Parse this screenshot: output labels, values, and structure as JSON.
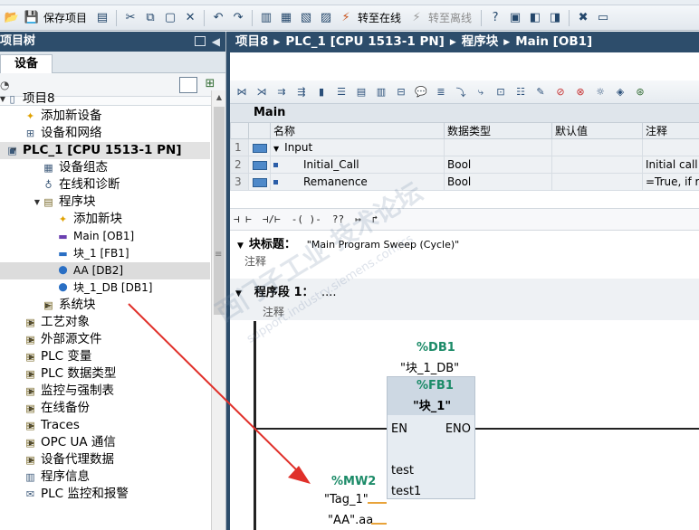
{
  "toolbar": {
    "save_project": "保存项目",
    "go_online": "转至在线",
    "go_offline": "转至离线"
  },
  "left": {
    "title": "项目树",
    "tab": "设备",
    "tree": [
      {
        "label": "项目8",
        "icon": "document-icon"
      },
      {
        "label": "添加新设备",
        "icon": "star-icon"
      },
      {
        "label": "设备和网络",
        "icon": "network-icon"
      },
      {
        "label": "PLC_1 [CPU 1513-1 PN]",
        "icon": "cpu-icon"
      },
      {
        "label": "设备组态",
        "icon": "config-icon"
      },
      {
        "label": "在线和诊断",
        "icon": "diagnostics-icon"
      },
      {
        "label": "程序块",
        "icon": "folder-icon"
      },
      {
        "label": "添加新块",
        "icon": "star-icon"
      },
      {
        "label": "Main [OB1]",
        "icon": "ob-icon"
      },
      {
        "label": "块_1 [FB1]",
        "icon": "fb-icon"
      },
      {
        "label": "AA [DB2]",
        "icon": "db-icon"
      },
      {
        "label": "块_1_DB [DB1]",
        "icon": "db-icon"
      },
      {
        "label": "系统块",
        "icon": "folder-icon"
      },
      {
        "label": "工艺对象",
        "icon": "folder-icon"
      },
      {
        "label": "外部源文件",
        "icon": "folder-icon"
      },
      {
        "label": "PLC 变量",
        "icon": "folder-icon"
      },
      {
        "label": "PLC 数据类型",
        "icon": "folder-icon"
      },
      {
        "label": "监控与强制表",
        "icon": "folder-icon"
      },
      {
        "label": "在线备份",
        "icon": "folder-icon"
      },
      {
        "label": "Traces",
        "icon": "folder-icon"
      },
      {
        "label": "OPC UA 通信",
        "icon": "folder-icon"
      },
      {
        "label": "设备代理数据",
        "icon": "folder-icon"
      },
      {
        "label": "程序信息",
        "icon": "info-icon"
      },
      {
        "label": "PLC 监控和报警",
        "icon": "alarm-icon"
      }
    ]
  },
  "breadcrumb": [
    "项目8",
    "PLC_1 [CPU 1513-1 PN]",
    "程序块",
    "Main [OB1]"
  ],
  "interface": {
    "title": "Main",
    "columns": [
      "名称",
      "数据类型",
      "默认值",
      "注释"
    ],
    "rows": [
      {
        "num": "1",
        "name": "Input",
        "type": "",
        "default": "",
        "comment": ""
      },
      {
        "num": "2",
        "name": "Initial_Call",
        "type": "Bool",
        "default": "",
        "comment": "Initial call o"
      },
      {
        "num": "3",
        "name": "Remanence",
        "type": "Bool",
        "default": "",
        "comment": "=True, if re"
      }
    ]
  },
  "ladder_toolbar": [
    "⊣ ⊢",
    "⊣/⊢",
    "-( )-",
    "??",
    "↦",
    "↱"
  ],
  "block": {
    "title_label": "块标题：",
    "title_value": "\"Main Program Sweep (Cycle)\"",
    "comment": "注释"
  },
  "segment": {
    "title": "程序段 1：",
    "title_rest": "....",
    "comment": "注释"
  },
  "ladder": {
    "db_addr": "%DB1",
    "db_name": "\"块_1_DB\"",
    "fb_addr": "%FB1",
    "fb_name": "\"块_1\"",
    "en": "EN",
    "eno": "ENO",
    "pin1": "test",
    "pin2": "test1",
    "mw_addr": "%MW2",
    "tag1": "\"Tag_1\"",
    "aa_aa": "\"AA\".aa"
  },
  "watermark": {
    "text": "西门子工业 技术论坛",
    "url": "support.industry.siemens.com/cs"
  },
  "colors": {
    "title_bar": "#2d4d6b",
    "address_green": "#1c8b68",
    "arrow_red": "#e0302a",
    "param_orange": "#e8a33a"
  }
}
